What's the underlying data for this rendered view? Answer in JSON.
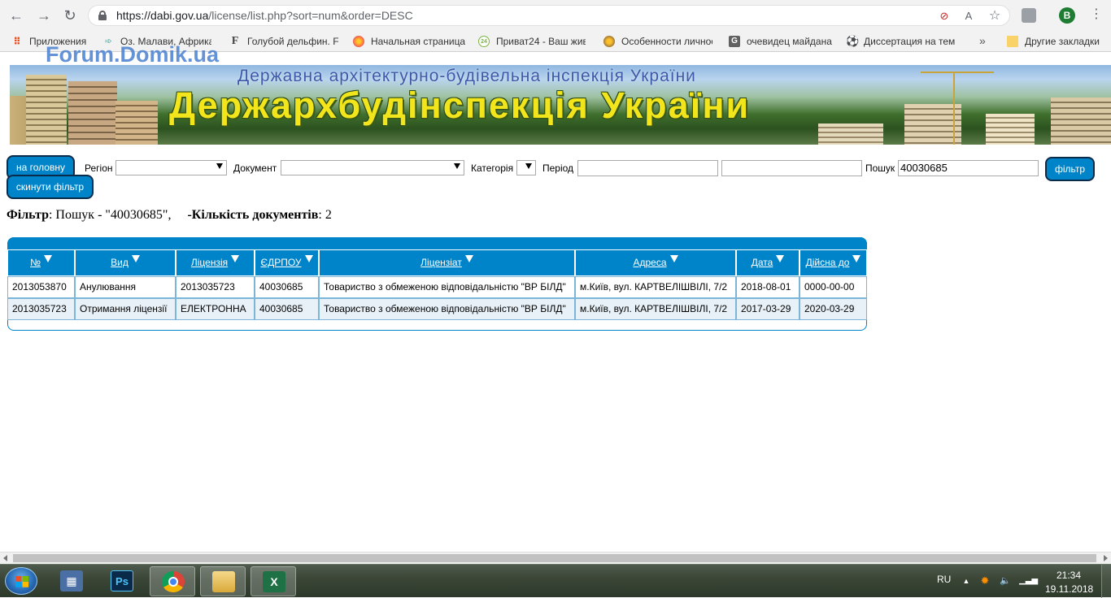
{
  "browser": {
    "url_host": "https://dabi.gov.ua",
    "url_path": "/license/list.php?sort=num&order=DESC",
    "profile_initial": "B",
    "bookmarks": [
      {
        "label": "Приложения",
        "icon": "apps-icon",
        "color": "#e64a19"
      },
      {
        "label": "Оз. Малави, Африка",
        "icon": "arrows-icon",
        "color": "#26a69a"
      },
      {
        "label": "Голубой дельфин. Fi",
        "icon": "f-letter-icon",
        "color": "#444444"
      },
      {
        "label": "Начальная страница",
        "icon": "firefox-icon",
        "color": "#ff7043"
      },
      {
        "label": "Приват24 - Ваш жив",
        "icon": "privat24-icon",
        "color": "#7cb342"
      },
      {
        "label": "Особенности личнос",
        "icon": "emblem-icon",
        "color": "#8d6e63"
      },
      {
        "label": "очевидец майдана",
        "icon": "g-letter-icon",
        "color": "#616161"
      },
      {
        "label": "Диссертация на тем",
        "icon": "soccer-ball-icon",
        "color": "#212121"
      }
    ],
    "more": "»",
    "other_bookmarks": "Другие закладки"
  },
  "watermark": "Forum.Domik.ua",
  "banner": {
    "subtitle": "Державна архітектурно-будівельна інспекція України",
    "title": "Держархбудінспекція України"
  },
  "filters": {
    "home_button": "на головну",
    "reset_button": "скинути фільтр",
    "region_label": "Регіон",
    "document_label": "Документ",
    "category_label": "Категорія",
    "period_label": "Період",
    "search_label": "Пошук",
    "search_value": "40030685",
    "filter_button": "фільтр"
  },
  "summary": {
    "filter_label": "Фільтр",
    "filter_text": ": Пошук - \"40030685\",",
    "count_label": "-Кількість документів",
    "count_value": ": 2"
  },
  "table": {
    "headers": [
      "№",
      "Вид",
      "Ліцензія",
      "ЄДРПОУ",
      "Ліцензіат",
      "Адреса",
      "Дата",
      "Дійсна до"
    ],
    "rows": [
      [
        "2013053870",
        "Анулювання",
        "2013035723",
        "40030685",
        "Товариство з обмеженою відповідальністю \"ВР БІЛД\"",
        "м.Київ, вул. КАРТВЕЛІШВІЛІ, 7/2",
        "2018-08-01",
        "0000-00-00"
      ],
      [
        "2013035723",
        "Отримання ліцензії",
        "ЕЛЕКТРОННА",
        "40030685",
        "Товариство з обмеженою відповідальністю \"ВР БІЛД\"",
        "м.Київ, вул. КАРТВЕЛІШВІЛІ, 7/2",
        "2017-03-29",
        "2020-03-29"
      ]
    ]
  },
  "taskbar": {
    "apps": [
      {
        "name": "calculator-icon",
        "glyph": "▦",
        "color": "#4a6fa5"
      },
      {
        "name": "photoshop-icon",
        "glyph": "Ps",
        "color": "#0a2a4a"
      },
      {
        "name": "chrome-icon",
        "glyph": "",
        "color": "#db4437"
      },
      {
        "name": "file-explorer-icon",
        "glyph": "",
        "color": "#e8b84a"
      },
      {
        "name": "excel-icon",
        "glyph": "X",
        "color": "#1e7145"
      }
    ],
    "language": "RU",
    "time": "21:34",
    "date": "19.11.2018"
  }
}
